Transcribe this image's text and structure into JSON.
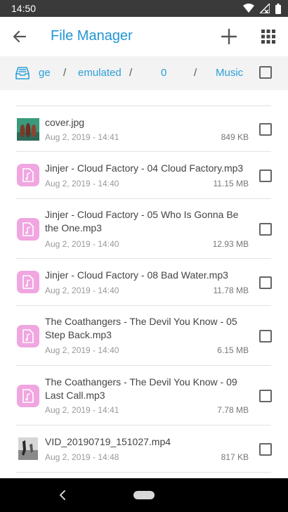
{
  "status": {
    "time": "14:50"
  },
  "appbar": {
    "title": "File Manager"
  },
  "breadcrumb": {
    "segments": [
      "ge",
      "emulated",
      "0",
      "Music"
    ],
    "separator": "/"
  },
  "files": [
    {
      "name": "cover.jpg",
      "date": "Aug 2, 2019 - 14:41",
      "size": "849 KB",
      "icon": "image-thumbnail"
    },
    {
      "name": "Jinjer - Cloud Factory - 04 Cloud Factory.mp3",
      "date": "Aug 2, 2019 - 14:40",
      "size": "11.15 MB",
      "icon": "audio-file-icon"
    },
    {
      "name": "Jinjer - Cloud Factory - 05 Who Is Gonna Be the One.mp3",
      "date": "Aug 2, 2019 - 14:40",
      "size": "12.93 MB",
      "icon": "audio-file-icon"
    },
    {
      "name": "Jinjer - Cloud Factory - 08 Bad Water.mp3",
      "date": "Aug 2, 2019 - 14:40",
      "size": "11.78 MB",
      "icon": "audio-file-icon"
    },
    {
      "name": "The Coathangers - The Devil You Know - 05 Step Back.mp3",
      "date": "Aug 2, 2019 - 14:40",
      "size": "6.15 MB",
      "icon": "audio-file-icon"
    },
    {
      "name": "The Coathangers - The Devil You Know - 09 Last Call.mp3",
      "date": "Aug 2, 2019 - 14:41",
      "size": "7.78 MB",
      "icon": "audio-file-icon"
    },
    {
      "name": "VID_20190719_151027.mp4",
      "date": "Aug 2, 2019 - 14:48",
      "size": "817 KB",
      "icon": "video-thumbnail"
    }
  ],
  "colors": {
    "accent": "#2196d6",
    "audio_icon": "#f0a6e0"
  }
}
